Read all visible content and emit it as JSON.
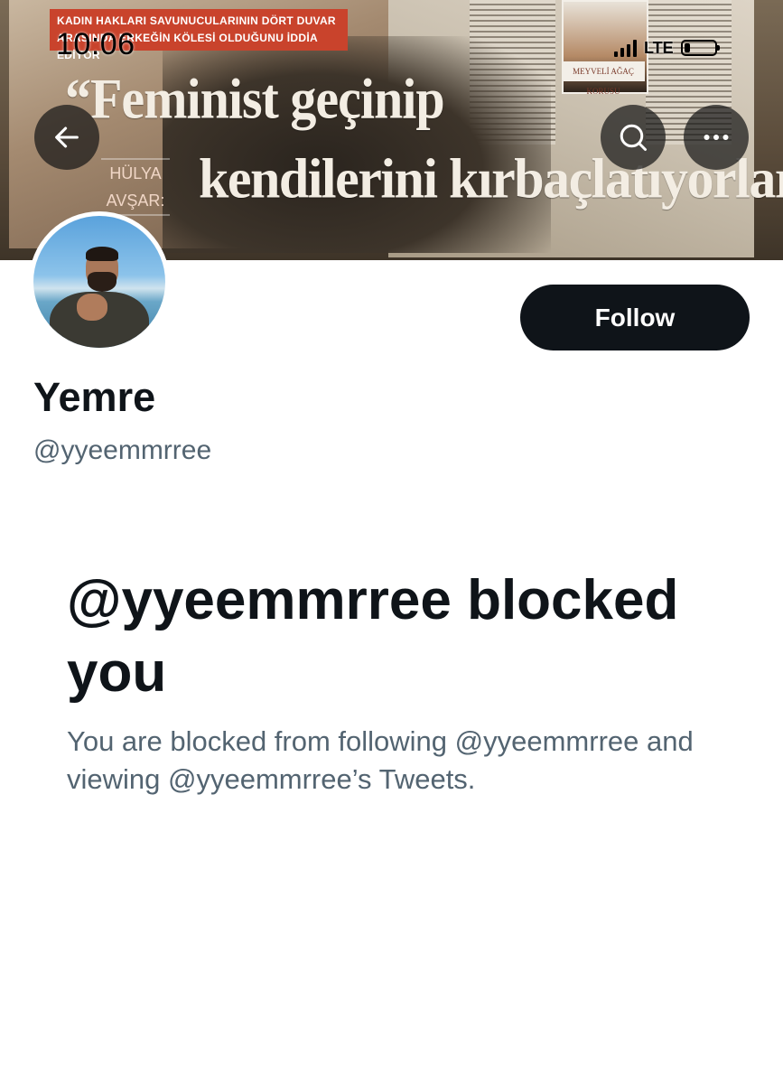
{
  "status_bar": {
    "time": "10:06",
    "network": "LTE"
  },
  "header_image": {
    "strip_text": "KADIN HAKLARI SAVUNUCULARININ DÖRT DUVAR ARASINDA ERKEĞİN KÖLESİ OLDUĞUNU İDDİA EDİYOR",
    "headline_line1": "“Feminist geçinip",
    "headline_line2": "kendilerini kırbaçlatıyorlar",
    "byline_line1": "HÜLYA",
    "byline_line2": "AVŞAR:",
    "inset_caption": "MEYVELİ AĞAÇ KORUSU"
  },
  "icons": {
    "back": "arrow-left-icon",
    "search": "search-icon",
    "more": "more-dots-icon"
  },
  "profile": {
    "display_name": "Yemre",
    "handle": "@yyeemmrree",
    "follow_label": "Follow"
  },
  "blocked": {
    "title": "@yyeemmrree blocked you",
    "description": "You are blocked from following @yyeemmrree and viewing @yyeemmrree’s Tweets."
  },
  "colors": {
    "primary_text": "#0f1419",
    "secondary_text": "#536471",
    "button_bg": "#0f1419",
    "button_text": "#ffffff"
  }
}
